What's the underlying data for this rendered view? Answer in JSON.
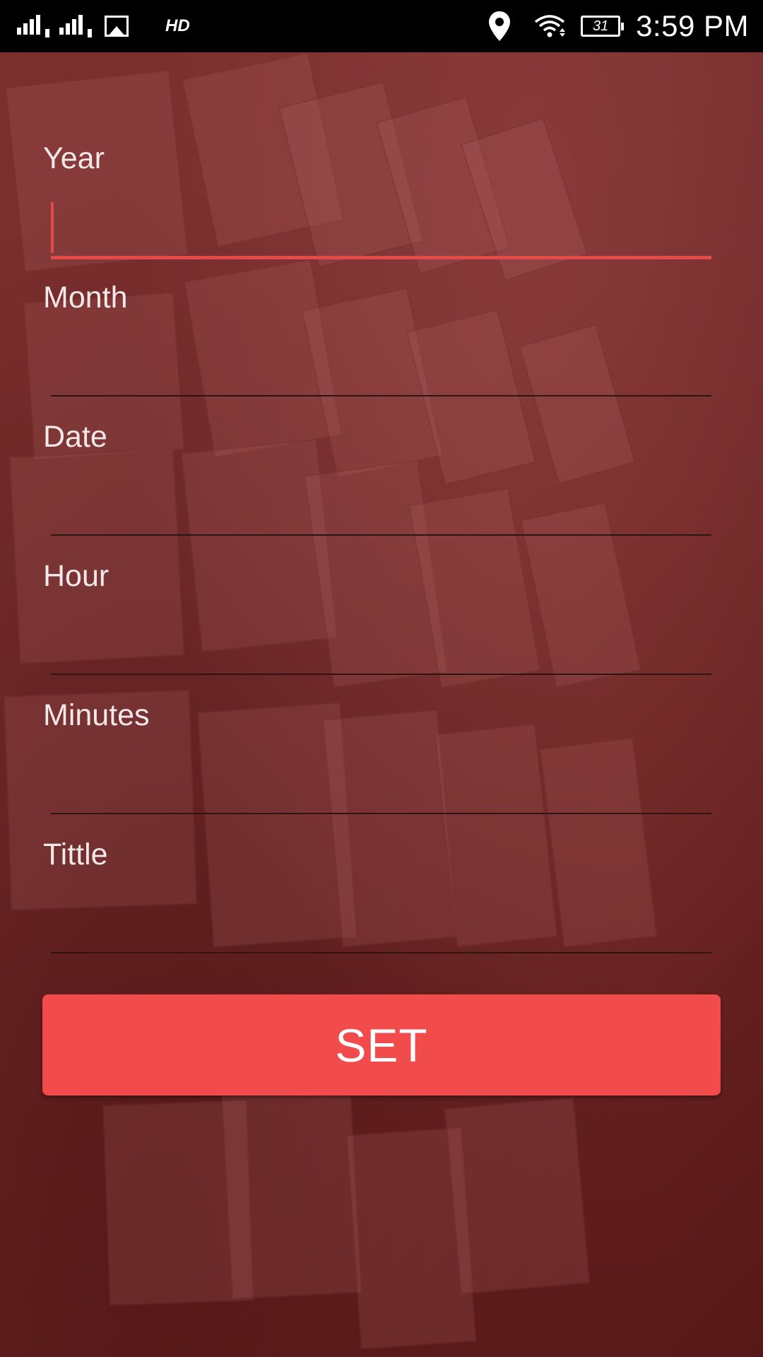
{
  "status_bar": {
    "sim1_number": "1",
    "sim2_number": "2",
    "hd_label": "HD",
    "battery_level": "31",
    "time": "3:59 PM",
    "icons": [
      "signal-icon",
      "signal-icon",
      "gallery-icon",
      "location-icon",
      "wifi-icon",
      "battery-icon"
    ]
  },
  "form": {
    "fields": [
      {
        "label": "Year",
        "value": "",
        "focused": true
      },
      {
        "label": "Month",
        "value": ""
      },
      {
        "label": "Date",
        "value": ""
      },
      {
        "label": "Hour",
        "value": ""
      },
      {
        "label": "Minutes",
        "value": ""
      },
      {
        "label": "Tittle",
        "value": ""
      }
    ],
    "set_button_label": "SET"
  },
  "colors": {
    "accent": "#e24b48",
    "button": "#f24b4b",
    "background": "#6e2524",
    "status_bar": "#000000"
  }
}
